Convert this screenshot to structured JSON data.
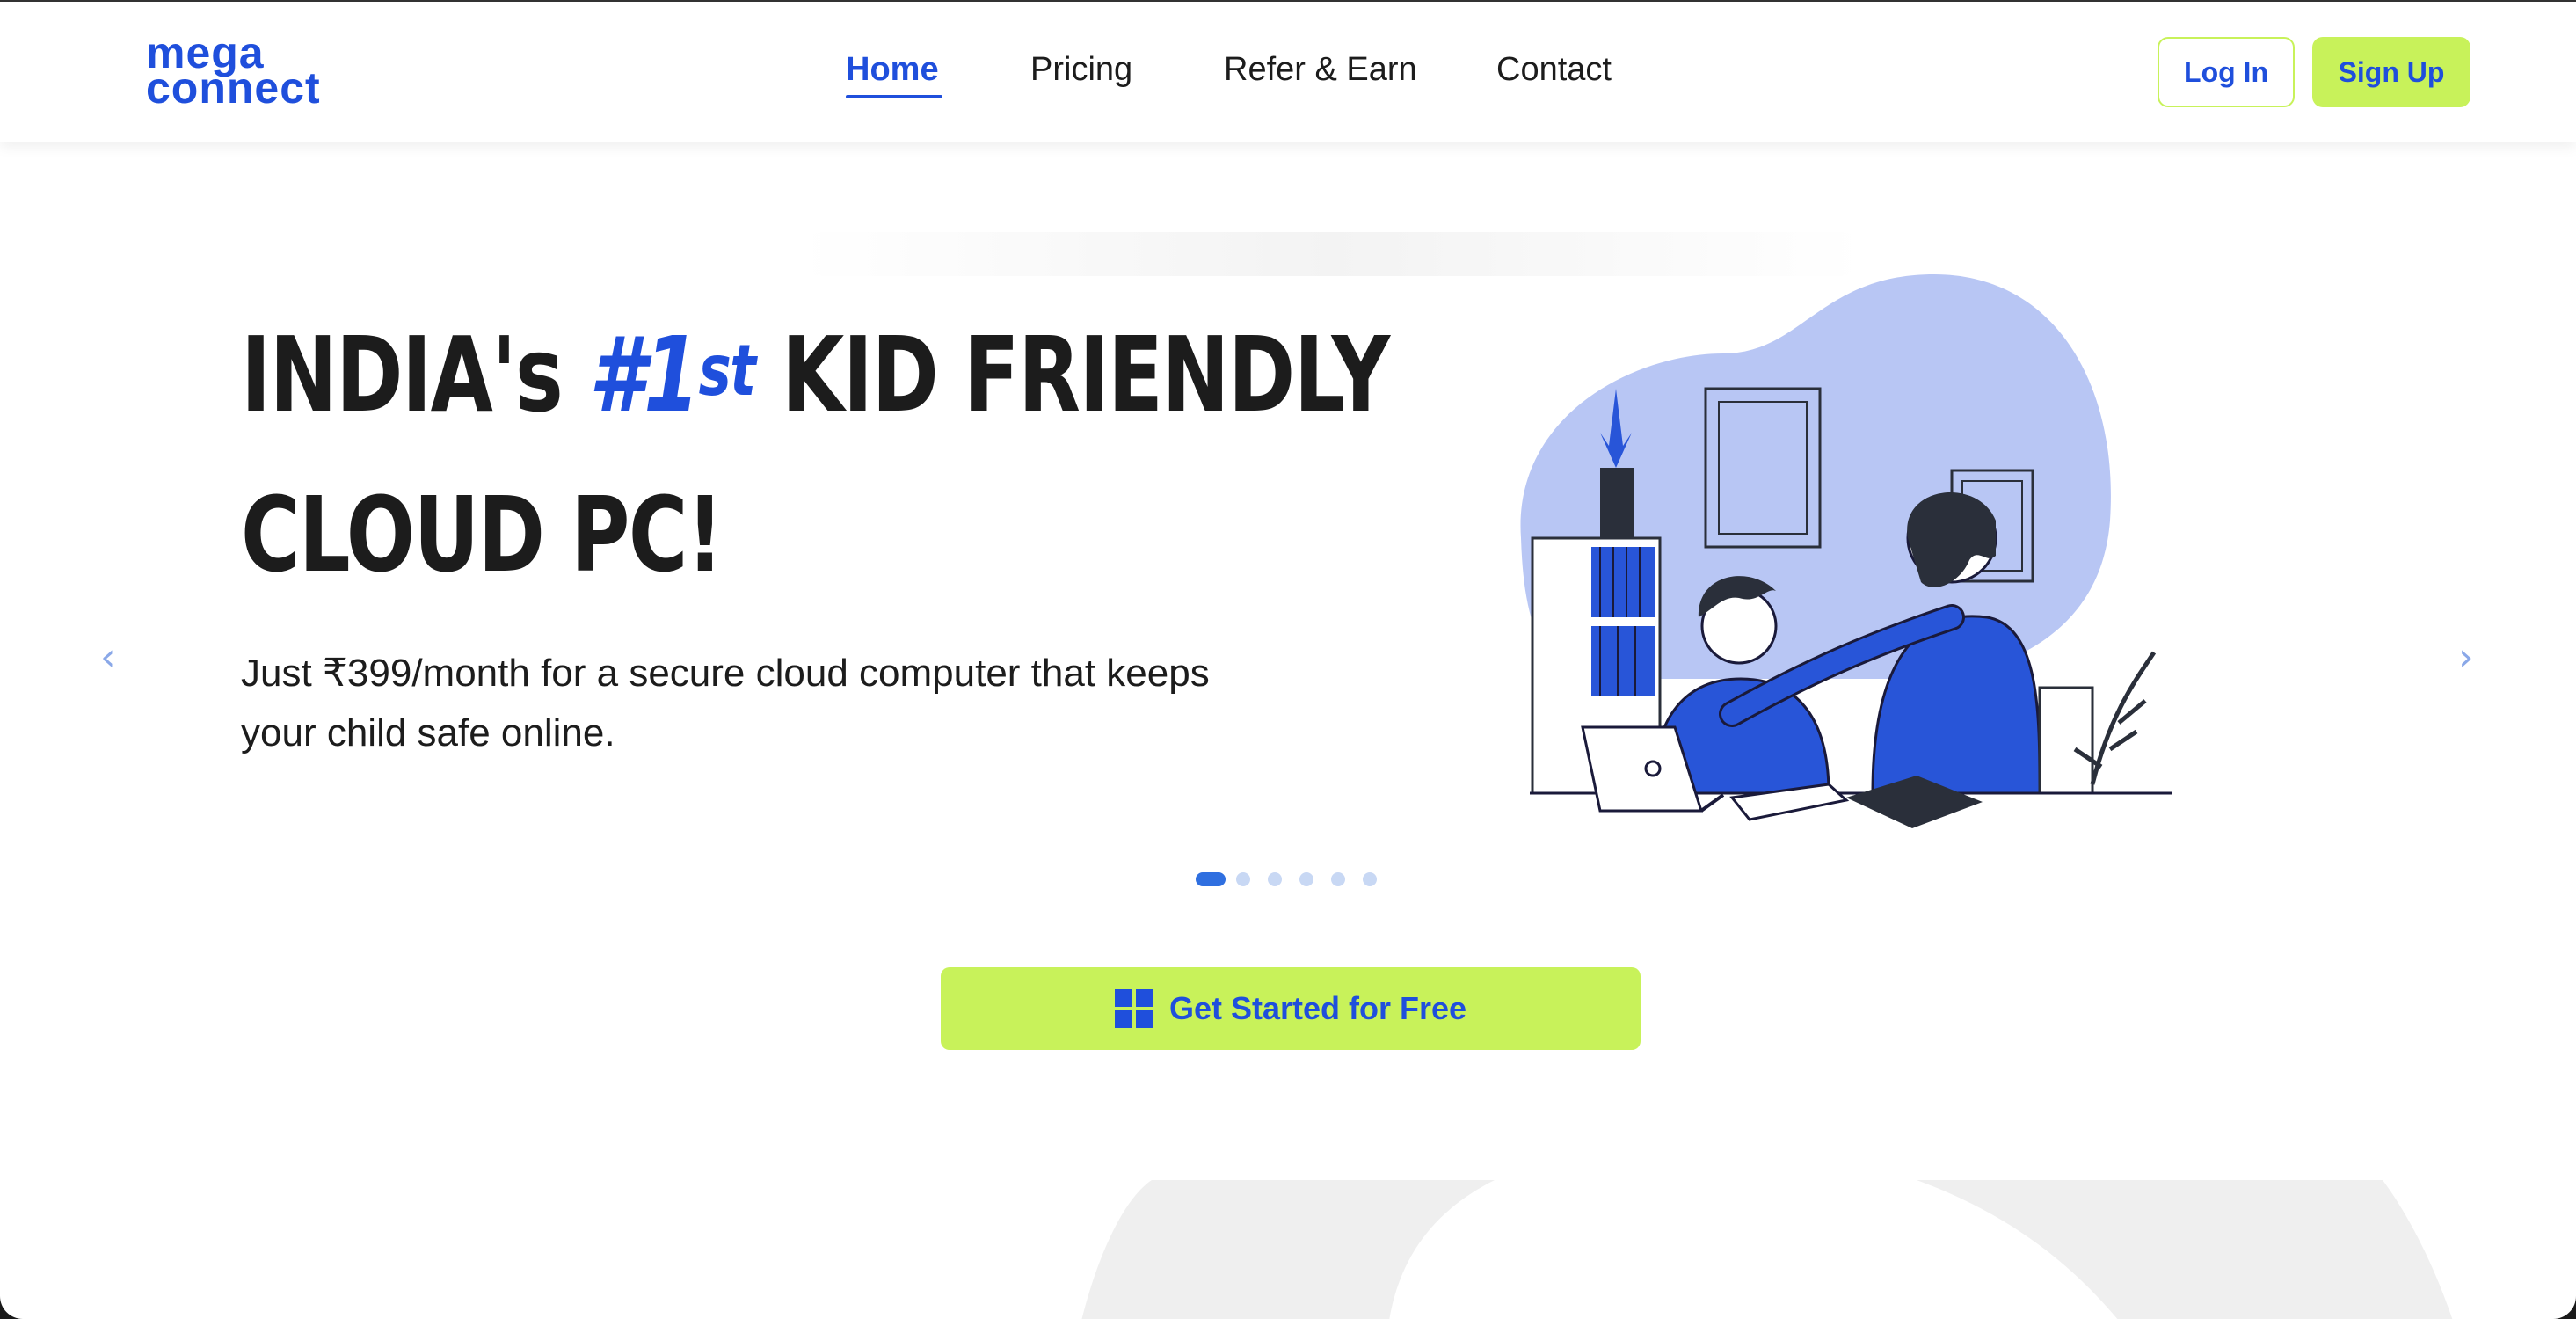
{
  "logo": {
    "line1": "mega",
    "line2": "connect"
  },
  "nav": [
    {
      "label": "Home",
      "active": true
    },
    {
      "label": "Pricing",
      "active": false
    },
    {
      "label": "Refer & Earn",
      "active": false
    },
    {
      "label": "Contact",
      "active": false
    }
  ],
  "auth": {
    "login_label": "Log In",
    "signup_label": "Sign Up"
  },
  "hero": {
    "title_prefix": "INDIA's",
    "title_accent": "#1",
    "title_sup": "st",
    "title_suffix": "KID FRIENDLY",
    "title_line2": "CLOUD PC!",
    "subtitle": "Just ₹399/month for a secure cloud computer that keeps your child safe online."
  },
  "carousel": {
    "prev_icon": "chevron-left-icon",
    "next_icon": "chevron-right-icon",
    "prev_glyph": "‹",
    "next_glyph": "›",
    "slide_count": 6,
    "active_slide": 1
  },
  "cta": {
    "label": "Get Started for Free",
    "icon": "windows-icon"
  },
  "colors": {
    "brand_blue": "#1f4fdc",
    "lime": "#c8f25a",
    "blob": "#b8c6f4",
    "text": "#1c1c1c"
  }
}
